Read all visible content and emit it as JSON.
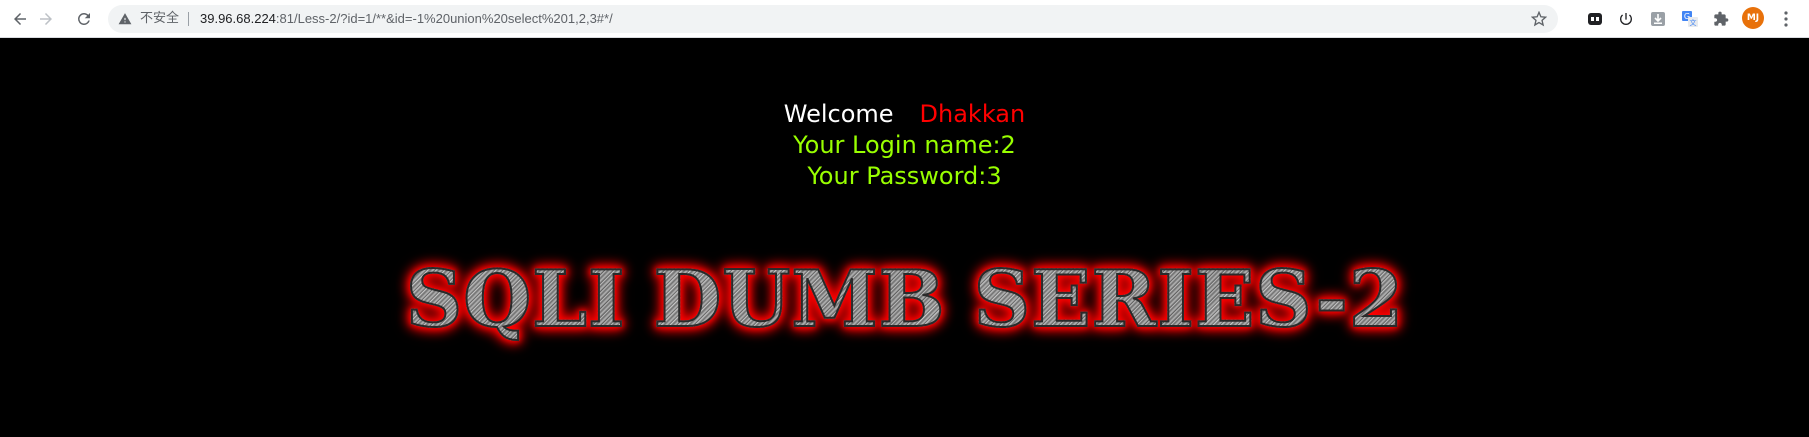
{
  "browser": {
    "security_label": "不安全",
    "url_host": "39.96.68.224",
    "url_rest": ":81/Less-2/?id=1/**&id=-1%20union%20select%201,2,3#*/",
    "avatar_initials": "MJ",
    "avatar_color": "#e8710a",
    "icons": [
      "back-icon",
      "forward-icon",
      "reload-icon",
      "warning-icon",
      "bookmark-star-icon",
      "extension-tab-icon",
      "power-icon",
      "download-icon",
      "translate-icon",
      "puzzle-icon",
      "menu-icon"
    ]
  },
  "page": {
    "welcome": "Welcome",
    "username": "Dhakkan",
    "login_name": "Your Login name:2",
    "password": "Your Password:3",
    "title_image_text": "SQLI DUMB SERIES-2",
    "colors": {
      "background": "#000000",
      "welcome": "#ffffff",
      "username": "#ff0000",
      "info": "#99ff00",
      "title_glow": "#ff0000"
    }
  }
}
